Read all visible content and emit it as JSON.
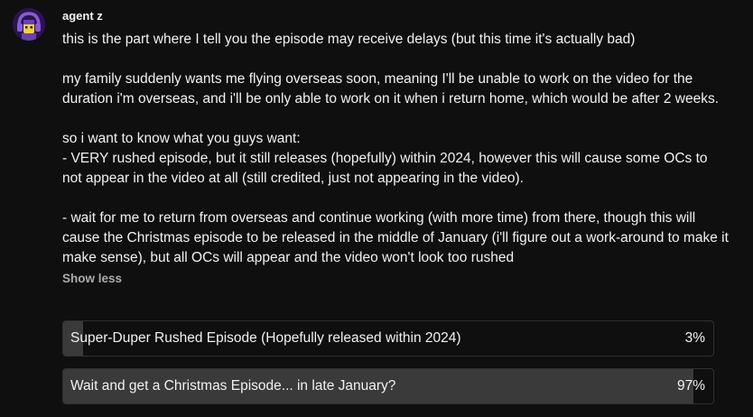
{
  "post": {
    "author": "agent z",
    "avatar_icon": "headphones-character-avatar",
    "paragraphs": [
      "this is the part where I tell you the episode may receive delays (but this time it's actually bad)",
      "my family suddenly wants me flying overseas soon, meaning I'll be unable to work on the video for the duration i'm overseas, and i'll be only able to work on it when i return home, which would be after 2 weeks.",
      "so i want to know what you guys want:\n- VERY rushed episode, but it still releases (hopefully) within 2024, however this will cause some OCs to not appear in the video at all (still credited, just not appearing in the video).",
      "- wait for me to return from overseas and continue working (with more time) from there, though this will cause the Christmas episode to be released in the middle of January (i'll figure out a work-around to make it make sense), but all OCs will appear and the video won't look too rushed"
    ],
    "show_less_label": "Show less"
  },
  "poll": {
    "options": [
      {
        "label": "Super-Duper Rushed Episode (Hopefully released within 2024)",
        "percent_label": "3%",
        "percent": 3
      },
      {
        "label": "Wait and get a Christmas Episode... in late January?",
        "percent_label": "97%",
        "percent": 97
      }
    ]
  },
  "colors": {
    "background": "#0f0f0f",
    "text": "#f1f1f1",
    "muted": "#aaaaaa",
    "poll_fill": "#3a3a3a",
    "avatar_purple": "#6a3fb5",
    "avatar_yellow": "#f5d23a"
  }
}
